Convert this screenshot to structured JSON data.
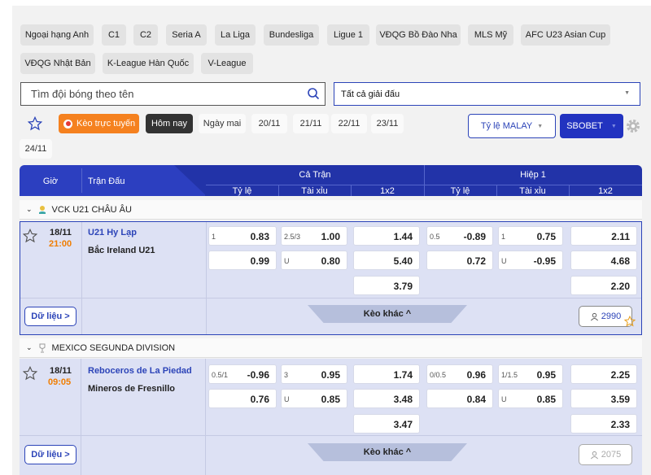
{
  "leagues_filter": [
    "Ngoại hạng Anh",
    "C1",
    "C2",
    "Seria A",
    "La Liga",
    "Bundesliga",
    "Ligue 1",
    "VĐQG Bồ Đào Nha",
    "MLS Mỹ",
    "AFC U23 Asian Cup",
    "VĐQG Nhật Bản",
    "K-League Hàn Quốc",
    "V-League"
  ],
  "search": {
    "placeholder": "Tìm đội bóng theo tên"
  },
  "league_select": {
    "value": "Tất cả giải đấu"
  },
  "filters": {
    "live": "Kèo trực tuyến",
    "today": "Hôm nay",
    "tomorrow": "Ngày mai",
    "dates": [
      "20/11",
      "21/11",
      "22/11",
      "23/11",
      "24/11"
    ]
  },
  "odds_type": "Tỷ lệ MALAY",
  "bookmaker": "SBOBET",
  "header": {
    "time": "Giờ",
    "match": "Trận Đấu",
    "full": "Cả Trận",
    "half": "Hiệp 1",
    "sub": [
      "Tỷ lệ",
      "Tài xỉu",
      "1x2",
      "Tỷ lệ",
      "Tài xỉu",
      "1x2"
    ]
  },
  "data_label": "Dữ liệu >",
  "more_label": "Kèo khác ^",
  "sections": [
    {
      "league": "VCK U21 CHÂU ÂU",
      "date": "18/11",
      "time": "21:00",
      "home": "U21 Hy Lạp",
      "away": "Bắc Ireland U21",
      "views": "2990",
      "full": {
        "hcap": [
          {
            "lbl": "1",
            "val": "0.83"
          },
          {
            "lbl": "",
            "val": "0.99"
          }
        ],
        "ou": [
          {
            "lbl": "2.5/3",
            "val": "1.00"
          },
          {
            "lbl": "U",
            "val": "0.80"
          }
        ],
        "x12": [
          "1.44",
          "5.40",
          "3.79"
        ]
      },
      "half": {
        "hcap": [
          {
            "lbl": "0.5",
            "val": "-0.89"
          },
          {
            "lbl": "",
            "val": "0.72"
          }
        ],
        "ou": [
          {
            "lbl": "1",
            "val": "0.75"
          },
          {
            "lbl": "U",
            "val": "-0.95"
          }
        ],
        "x12": [
          "2.11",
          "4.68",
          "2.20"
        ]
      }
    },
    {
      "league": "MEXICO SEGUNDA DIVISION",
      "date": "18/11",
      "time": "09:05",
      "home": "Reboceros de La Piedad",
      "away": "Mineros de Fresnillo",
      "views": "2075",
      "full": {
        "hcap": [
          {
            "lbl": "0.5/1",
            "val": "-0.96"
          },
          {
            "lbl": "",
            "val": "0.76"
          }
        ],
        "ou": [
          {
            "lbl": "3",
            "val": "0.95"
          },
          {
            "lbl": "U",
            "val": "0.85"
          }
        ],
        "x12": [
          "1.74",
          "3.48",
          "3.47"
        ]
      },
      "half": {
        "hcap": [
          {
            "lbl": "0/0.5",
            "val": "0.96"
          },
          {
            "lbl": "",
            "val": "0.84"
          }
        ],
        "ou": [
          {
            "lbl": "1/1.5",
            "val": "0.95"
          },
          {
            "lbl": "U",
            "val": "0.85"
          }
        ],
        "x12": [
          "2.25",
          "3.59",
          "2.33"
        ]
      }
    }
  ]
}
